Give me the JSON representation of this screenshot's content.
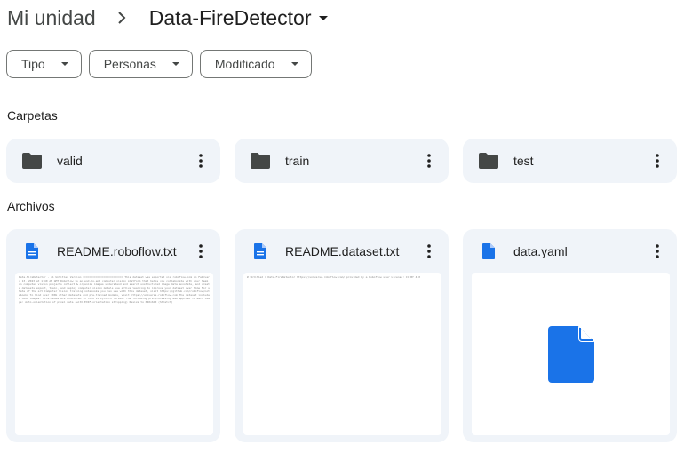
{
  "breadcrumb": {
    "root": "Mi unidad",
    "current": "Data-FireDetector"
  },
  "filters": [
    {
      "label": "Tipo"
    },
    {
      "label": "Personas"
    },
    {
      "label": "Modificado"
    }
  ],
  "sections": {
    "folders_label": "Carpetas",
    "files_label": "Archivos"
  },
  "folders": [
    {
      "name": "valid"
    },
    {
      "name": "train"
    },
    {
      "name": "test"
    }
  ],
  "files": [
    {
      "name": "README.roboflow.txt",
      "type": "doc",
      "preview": "Data-FireDetector - v1 Untitled Version ========================= This dataset was exported via roboflow.com on February 13, 2023 at 1:40 AM GMT Roboflow is an end-to-end computer vision platform that helps you collaborate with your team on computer vision projects collect & organize images understand and search unstructured image data annotate, and create datasets export, train, and deploy computer vision models use active learning to improve your dataset over time For state of the art Computer Vision training notebooks you can use with this dataset, visit https://github.com/roboflow/notebooks To find over 100k other datasets and pre-trained models, visit https://universe.roboflow.com The dataset includes 3000 images. Fire-smoke are annotated in YOLO v5 PyTorch format. The following pre-processing was applied to each image: Auto-orientation of pixel data (with EXIF-orientation stripping) Resize to 640x640 (Stretch)"
    },
    {
      "name": "README.dataset.txt",
      "type": "doc",
      "preview": "# Untitled > Data-FireDetector https://universe.roboflow.com/ provided by a Roboflow user License: CC BY 4.0"
    },
    {
      "name": "data.yaml",
      "type": "doc-blank",
      "preview": ""
    }
  ],
  "colors": {
    "accent_blue": "#1a73e8",
    "card_bg": "#f0f4f9",
    "folder_icon": "#444746"
  }
}
